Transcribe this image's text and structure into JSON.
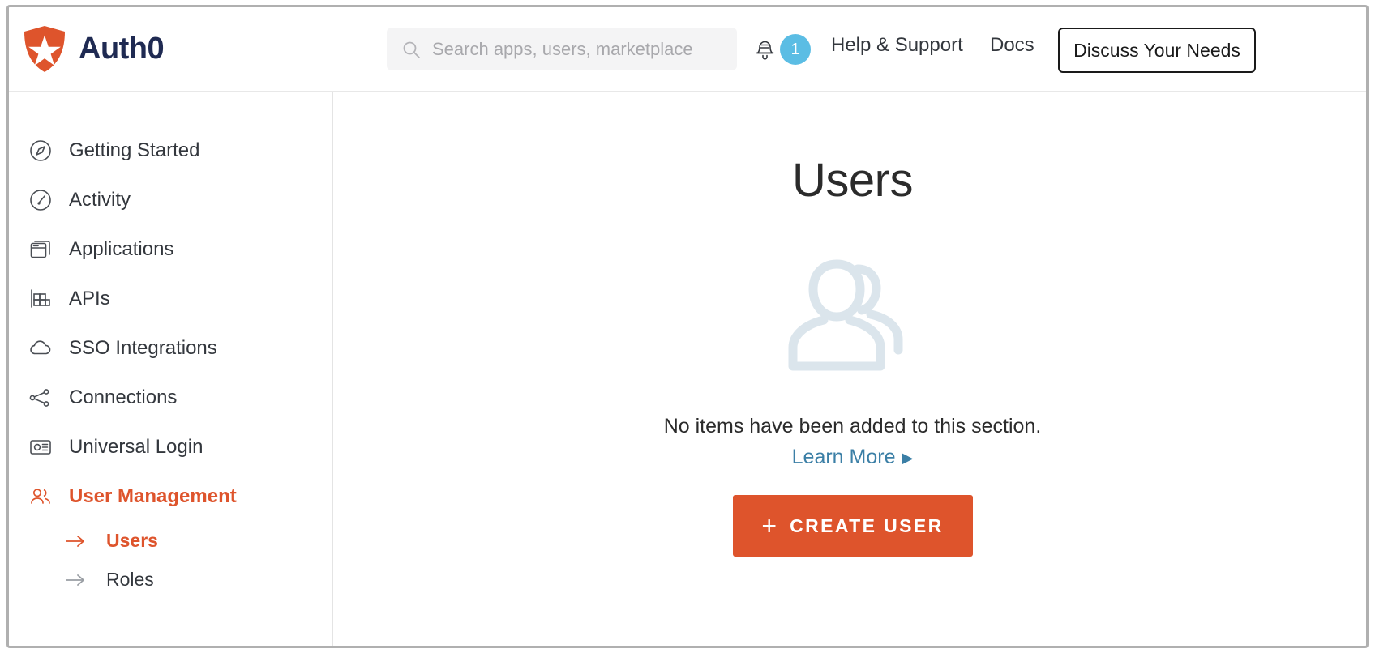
{
  "brand": {
    "name": "Auth0",
    "logo_icon": "auth0-shield-star-logo",
    "logo_color": "#DE542C",
    "text_color": "#1F2A52"
  },
  "header": {
    "search": {
      "placeholder": "Search apps, users, marketplace",
      "value": "",
      "icon": "search-icon"
    },
    "notifications": {
      "icon": "bell-icon",
      "count": "1",
      "badge_color": "#5BBDE4"
    },
    "help_label": "Help & Support",
    "docs_label": "Docs",
    "discuss_label": "Discuss Your Needs"
  },
  "sidebar": {
    "items": [
      {
        "label": "Getting Started",
        "icon": "compass-icon",
        "active": false
      },
      {
        "label": "Activity",
        "icon": "gauge-icon",
        "active": false
      },
      {
        "label": "Applications",
        "icon": "windows-stack-icon",
        "active": false
      },
      {
        "label": "APIs",
        "icon": "bar-blocks-icon",
        "active": false
      },
      {
        "label": "SSO Integrations",
        "icon": "cloud-icon",
        "active": false
      },
      {
        "label": "Connections",
        "icon": "share-nodes-icon",
        "active": false
      },
      {
        "label": "Universal Login",
        "icon": "id-card-icon",
        "active": false
      },
      {
        "label": "User Management",
        "icon": "users-icon",
        "active": true
      }
    ],
    "sub_items": [
      {
        "label": "Users",
        "icon": "arrow-right-icon",
        "active": true
      },
      {
        "label": "Roles",
        "icon": "arrow-right-icon",
        "active": false
      }
    ],
    "active_color": "#DE542C"
  },
  "main": {
    "title": "Users",
    "illustration_icon": "users-silhouette-illustration",
    "illustration_color": "#DBE5EC",
    "empty_message": "No items have been added to this section.",
    "learn_more_label": "Learn More",
    "learn_more_caret": "▶",
    "learn_more_color": "#3B7FA6",
    "create_button": {
      "label": "CREATE USER",
      "plus": "+",
      "color": "#DE542C"
    }
  }
}
